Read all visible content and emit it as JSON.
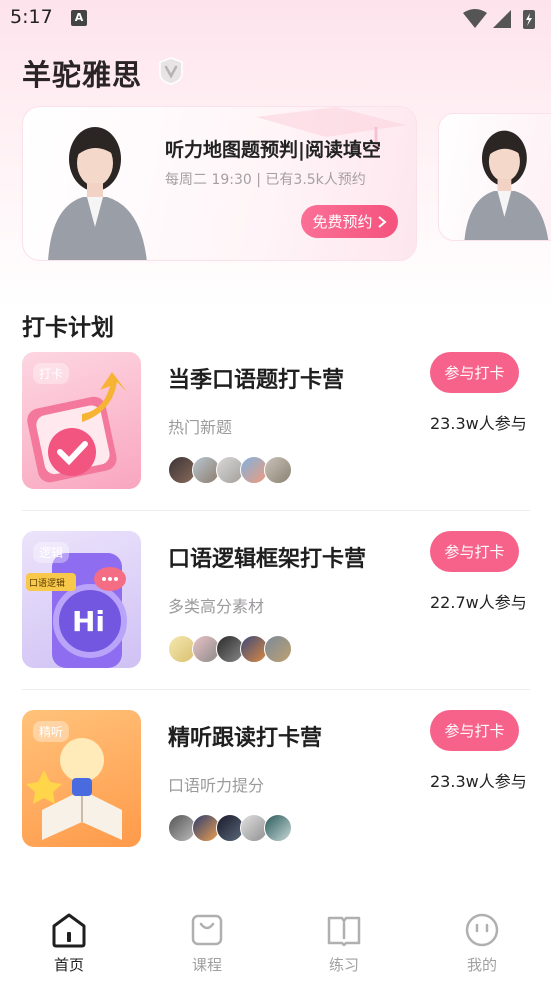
{
  "status": {
    "time": "5:17",
    "a_icon": "A"
  },
  "header": {
    "title": "羊驼雅思",
    "badge_icon": "vip-shield-icon"
  },
  "live_cards": [
    {
      "title": "听力地图题预判|阅读填空",
      "subtitle": "每周二 19:30 | 已有3.5k人预约",
      "button": "免费预约"
    }
  ],
  "section": {
    "title": "打卡计划"
  },
  "plans": [
    {
      "tag": "打卡",
      "name": "当季口语题打卡营",
      "desc": "热门新题",
      "button": "参与打卡",
      "count": "23.3w人参与"
    },
    {
      "tag": "逻辑",
      "name": "口语逻辑框架打卡营",
      "desc": "多类高分素材",
      "button": "参与打卡",
      "count": "22.7w人参与",
      "thumb_text": "口语逻辑",
      "thumb_hi": "Hi"
    },
    {
      "tag": "精听",
      "name": "精听跟读打卡营",
      "desc": "口语听力提分",
      "button": "参与打卡",
      "count": "23.3w人参与"
    }
  ],
  "nav": [
    {
      "label": "首页",
      "icon": "home-icon",
      "active": true
    },
    {
      "label": "课程",
      "icon": "course-bag-icon",
      "active": false
    },
    {
      "label": "练习",
      "icon": "book-icon",
      "active": false
    },
    {
      "label": "我的",
      "icon": "profile-face-icon",
      "active": false
    }
  ],
  "colors": {
    "accent": "#f7628a",
    "bg_top": "#fde3ec"
  }
}
